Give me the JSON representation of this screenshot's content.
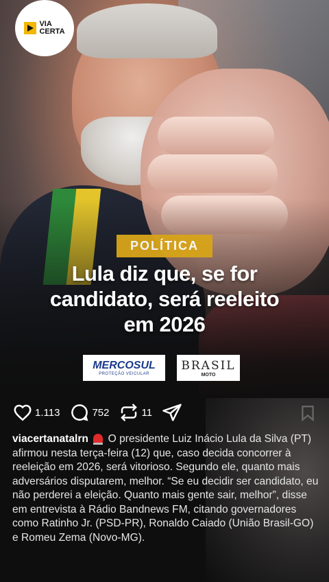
{
  "brand": {
    "logo_line1": "VIA",
    "logo_line2": "CERTA"
  },
  "post_image": {
    "category": "POLÍTICA",
    "headline_line1": "Lula diz que, se for",
    "headline_line2": "candidato, será reeleito",
    "headline_line3": "em 2026",
    "sponsors": [
      {
        "name": "MERCOSUL",
        "tagline": "PROTEÇÃO VEICULAR"
      },
      {
        "name": "BRASIL",
        "tagline": "MOTO"
      }
    ]
  },
  "actions": {
    "likes": "1.113",
    "comments": "752",
    "reposts": "11"
  },
  "caption": {
    "username": "viacertanatalrn",
    "text": "O presidente Luiz Inácio Lula da Silva (PT) afirmou nesta terça-feira (12) que, caso decida concorrer à reeleição em 2026, será vitorioso. Segundo ele, quanto mais adversários disputarem, melhor. “Se eu decidir ser candidato, eu não perderei a eleição. Quanto mais gente sair, melhor”, disse em entrevista à Rádio Bandnews FM, citando governadores como Ratinho Jr. (PSD-PR), Ronaldo Caiado (União Brasil-GO) e Romeu Zema (Novo-MG)."
  },
  "icons": {
    "like": "heart-icon",
    "comment": "comment-bubble-icon",
    "repost": "repost-icon",
    "share": "send-icon",
    "save": "bookmark-icon",
    "alert": "siren-emoji-icon"
  },
  "colors": {
    "category_bg": "#d8a419",
    "background": "#0e0e0e"
  }
}
